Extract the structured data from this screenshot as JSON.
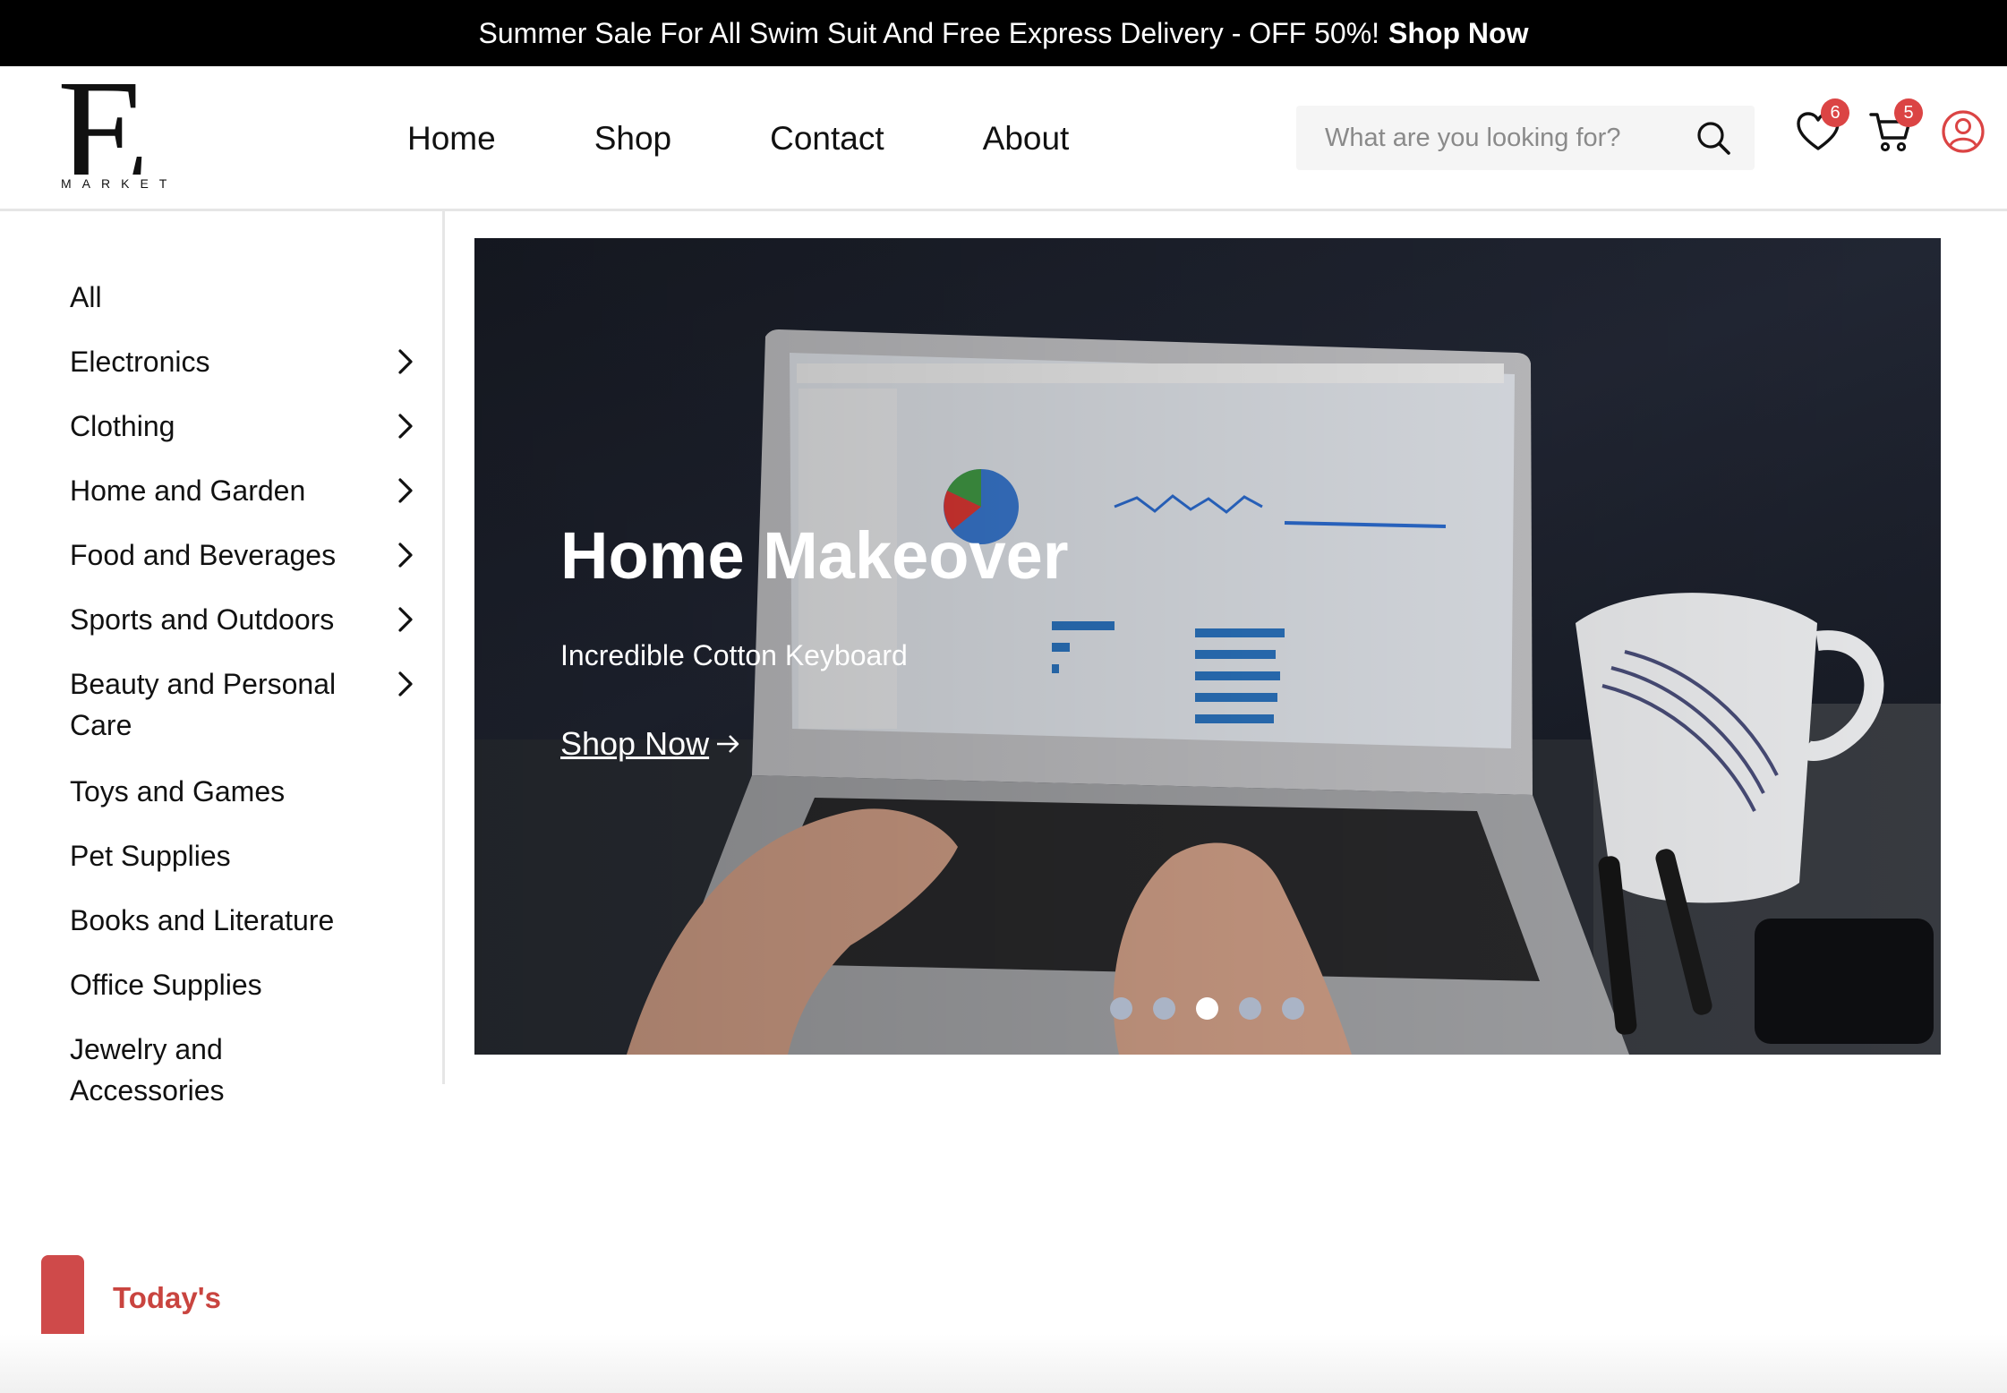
{
  "topbar": {
    "message": "Summer Sale For All Swim Suit And Free Express Delivery - OFF 50%!",
    "cta": "Shop Now"
  },
  "logo": {
    "letter": "E",
    "word": "MARKET"
  },
  "nav": [
    {
      "label": "Home"
    },
    {
      "label": "Shop"
    },
    {
      "label": "Contact"
    },
    {
      "label": "About"
    }
  ],
  "search": {
    "placeholder": "What are you looking for?",
    "icon": "search-icon"
  },
  "header_icons": {
    "wishlist_count": "6",
    "cart_count": "5",
    "badge_color": "#db4444",
    "account_color": "#db4444"
  },
  "categories": [
    {
      "label": "All",
      "has_submenu": false
    },
    {
      "label": "Electronics",
      "has_submenu": true
    },
    {
      "label": "Clothing",
      "has_submenu": true
    },
    {
      "label": "Home and Garden",
      "has_submenu": true
    },
    {
      "label": "Food and Beverages",
      "has_submenu": true
    },
    {
      "label": "Sports and Outdoors",
      "has_submenu": true
    },
    {
      "label": "Beauty and Personal Care",
      "has_submenu": true
    },
    {
      "label": "Toys and Games",
      "has_submenu": false
    },
    {
      "label": "Pet Supplies",
      "has_submenu": false
    },
    {
      "label": "Books and Literature",
      "has_submenu": false
    },
    {
      "label": "Office Supplies",
      "has_submenu": false
    },
    {
      "label": "Jewelry and Accessories",
      "has_submenu": false
    }
  ],
  "hero": {
    "title": "Home Makeover",
    "subtitle": "Incredible Cotton Keyboard",
    "cta": "Shop Now",
    "slide_count": 5,
    "active_slide": 3
  },
  "section": {
    "label": "Today's",
    "accent": "#cf4a4a"
  }
}
